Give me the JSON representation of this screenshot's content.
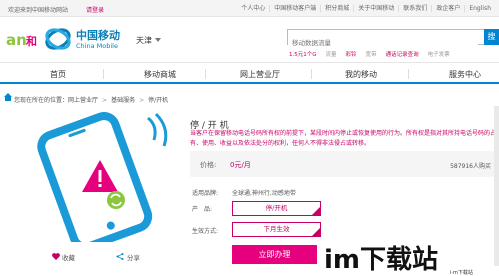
{
  "topbar": {
    "welcome": "欢迎来到中国移动网站",
    "login": "请登录",
    "links": [
      "个人中心",
      "中国移动客户端",
      "积分商城",
      "关于中国移动",
      "联系我们",
      "政企客户",
      "English"
    ]
  },
  "header": {
    "brand_cn": "中国移动",
    "brand_en": "China Mobile",
    "city": "天津",
    "search_placeholder": "移动数据流量",
    "search_button": "搜索",
    "hot_keywords": [
      "1.5元1个G",
      "流量",
      "彩铃",
      "宽带",
      "通话记录查询",
      "电子发票"
    ]
  },
  "nav": {
    "items": [
      "首页",
      "移动商城",
      "网上营业厅",
      "我的移动",
      "服务中心"
    ]
  },
  "breadcrumb": {
    "prefix": "您现在所在的位置：",
    "items": [
      "网上营业厅",
      "基础服务",
      "停/开机"
    ]
  },
  "product": {
    "title": "停 / 开 机",
    "description": "当客户在保留移动电话号码所有权的前提下，某段时间内停止或恢复使用的行为。所有权是指对其所持电话号码的占有、使用、收益以及依法处分的权利，任何人不得非法侵占或转移。",
    "price_label": "价格:",
    "price_value": "0元/月",
    "purchases": "587916人购买",
    "brand_label": "适用品牌:",
    "brand_value": "全球通,神州行,动感地带",
    "product_label": "产　品:",
    "product_option": "停/开机",
    "effect_label": "生效方式:",
    "effect_option": "下月生效",
    "buy_button": "立即办理",
    "favorite": "收藏",
    "share": "分享"
  },
  "watermark": {
    "text": "im下载站",
    "subtext": "i·m下载站"
  },
  "colors": {
    "brand_blue": "#0085d0",
    "accent_magenta": "#c80066",
    "buy_button": "#e6007e"
  }
}
